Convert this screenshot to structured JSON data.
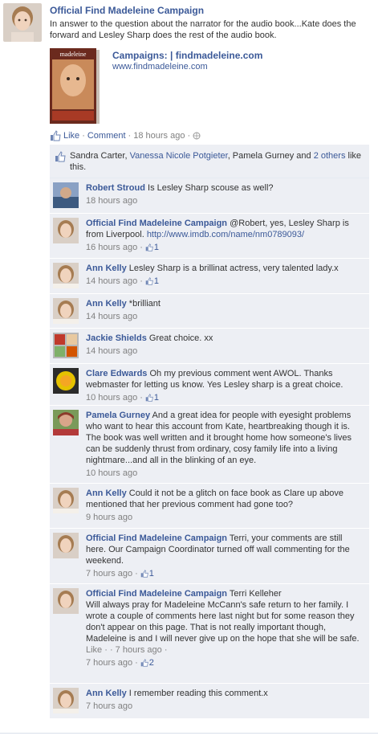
{
  "post": {
    "author": "Official Find Madeleine Campaign",
    "text": "In answer to the question about the narrator for the audio book...Kate does the forward and Lesley Sharp does the rest of the audio book.",
    "attachment": {
      "thumb_title": "madeleine",
      "title": "Campaigns: | findmadeleine.com",
      "url": "www.findmadeleine.com"
    },
    "actions": {
      "like": "Like",
      "sep1": "·",
      "comment": "Comment",
      "sep2": "·",
      "time": "18 hours ago",
      "sep3": "·"
    }
  },
  "likes_bar": {
    "name1": "Sandra Carter, ",
    "name2": "Vanessa Nicole Potgieter",
    "name3": ", Pamela Gurney and ",
    "others": "2 others",
    "suffix": " like this."
  },
  "comments": [
    {
      "author": "Robert Stroud",
      "text": "Is Lesley Sharp scouse as well?",
      "time": "18 hours ago",
      "likes": ""
    },
    {
      "author": "Official Find Madeleine Campaign",
      "text": "@Robert, yes, Lesley Sharp is from Liverpool. ",
      "link": "http://www.imdb.com/name/nm0789093/",
      "time": "16 hours ago",
      "likes": "1"
    },
    {
      "author": "Ann Kelly",
      "text": "Lesley Sharp is a brillinat actress, very talented lady.x",
      "time": "14 hours ago",
      "likes": "1"
    },
    {
      "author": "Ann Kelly",
      "text": "*brilliant",
      "time": "14 hours ago",
      "likes": ""
    },
    {
      "author": "Jackie Shields",
      "text": "Great choice. xx",
      "time": "14 hours ago",
      "likes": ""
    },
    {
      "author": "Clare Edwards",
      "text": "Oh my previous comment went AWOL. Thanks webmaster for letting us know. Yes Lesley sharp is a great choice.",
      "time": "10 hours ago",
      "likes": "1"
    },
    {
      "author": "Pamela Gurney",
      "text": "And a great idea for people with eyesight problems who want to hear this account from Kate, heartbreaking though it is. The book was well written and it brought home how someone's lives can be suddenly thrust from ordinary, cosy family life into a living nightmare...and all in the blinking of an eye.",
      "time": "10 hours ago",
      "likes": ""
    },
    {
      "author": "Ann Kelly",
      "text": "Could it not be a glitch on face book as Clare up above mentioned that her previous comment had gone too?",
      "time": "9 hours ago",
      "likes": ""
    },
    {
      "author": "Official Find Madeleine Campaign",
      "text": "Terri, your comments are still here. Our Campaign Coordinator turned off wall commenting for the weekend.",
      "time": "7 hours ago",
      "likes": "1"
    },
    {
      "author": "Official Find Madeleine Campaign",
      "text": "Terri Kelleher",
      "text2": "Will always pray for Madeleine McCann's safe return to her family. I wrote a couple of comments here last night but for some reason they don't appear on this page. That is not really important though, Madeleine is and I will never give up on the hope that she will be safe.",
      "inner_meta": "Like · · 7 hours ago ·",
      "time": "7 hours ago",
      "likes": "2"
    },
    {
      "author": "Ann Kelly",
      "text": "I remember reading this comment.x",
      "time": "7 hours ago",
      "likes": ""
    }
  ],
  "colors": {
    "link": "#3b5998",
    "ufi_bg": "#edeff4",
    "meta": "#808080"
  }
}
